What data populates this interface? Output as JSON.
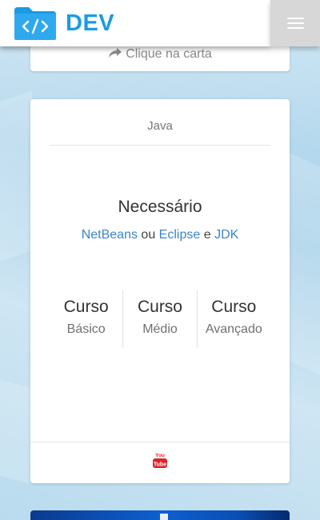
{
  "header": {
    "brand": "DEV",
    "logo_icon": "code-folder-icon",
    "menu_icon": "hamburger-menu-icon",
    "brand_color": "#1a9be5"
  },
  "previous_card": {
    "hint_icon": "share-arrow-icon",
    "hint_text": "Clique na carta"
  },
  "card": {
    "title": "Java",
    "requirements_heading": "Necessário",
    "requirements": {
      "tool1": "NetBeans",
      "sep1": "ou",
      "tool2": "Eclipse",
      "sep2": "e",
      "tool3": "JDK"
    },
    "courses": [
      {
        "title": "Curso",
        "level": "Básico"
      },
      {
        "title": "Curso",
        "level": "Médio"
      },
      {
        "title": "Curso",
        "level": "Avançado"
      }
    ],
    "footer_icon": "youtube-icon",
    "link_color": "#3a86c8"
  }
}
